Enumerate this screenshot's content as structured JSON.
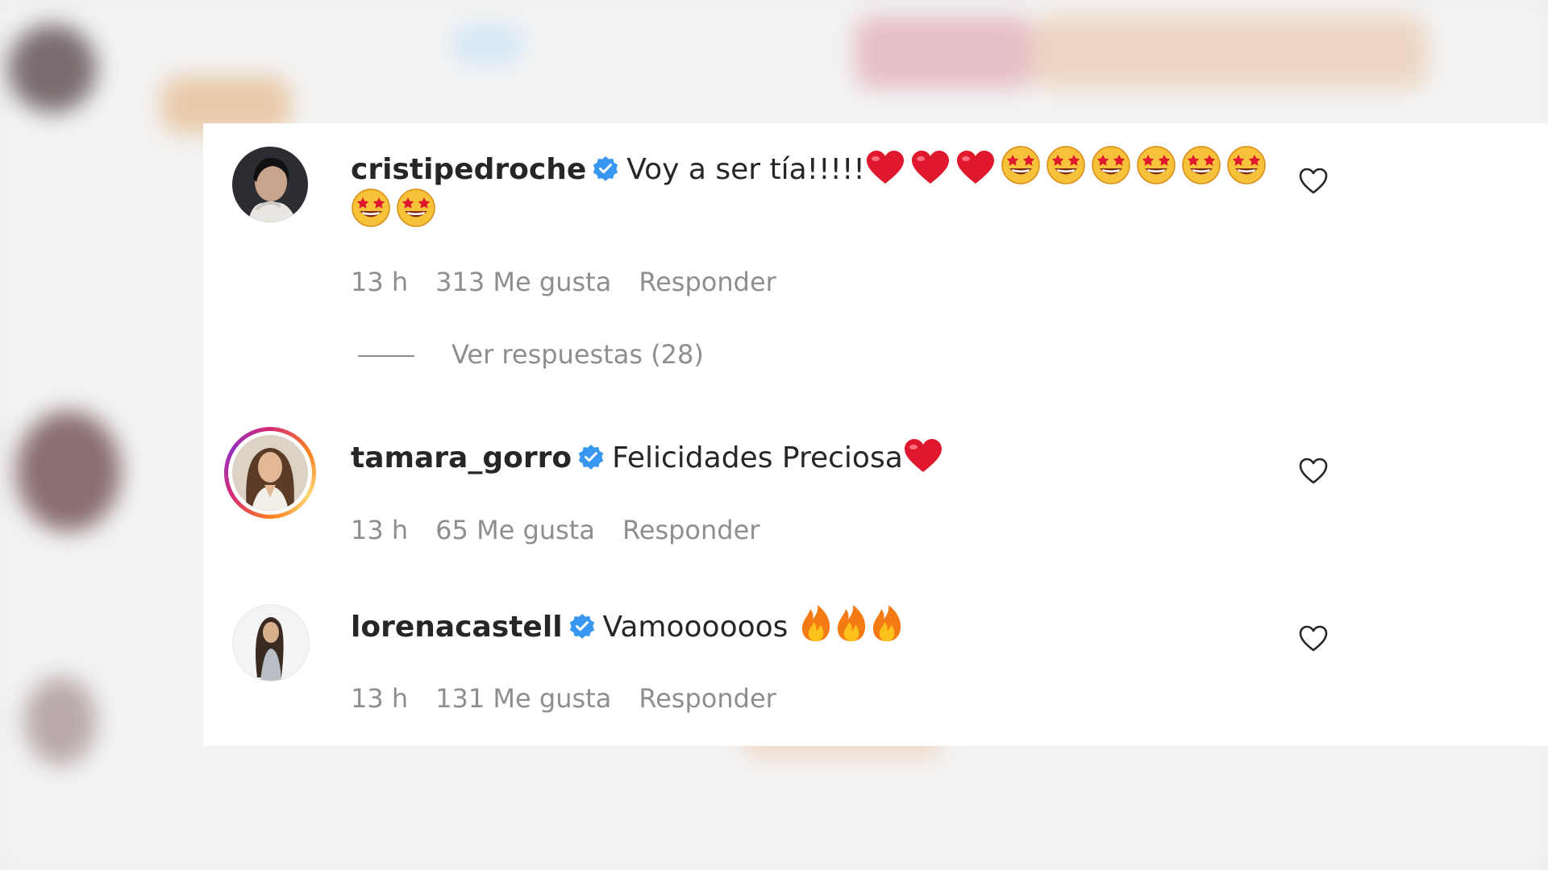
{
  "comments": [
    {
      "username": "cristipedroche",
      "verified": true,
      "text": "Voy a ser tía!!!!!",
      "emojis_line1": [
        "heart",
        "heart",
        "heart",
        "star-eyes",
        "star-eyes",
        "star-eyes",
        "star-eyes",
        "star-eyes",
        "star-eyes"
      ],
      "emojis_line2": [
        "star-eyes",
        "star-eyes"
      ],
      "time": "13 h",
      "likes": "313 Me gusta",
      "reply": "Responder"
    },
    {
      "username": "tamara_gorro",
      "verified": true,
      "text": "Felicidades Preciosa",
      "emojis_line1": [
        "heart"
      ],
      "time": "13 h",
      "likes": "65 Me gusta",
      "reply": "Responder"
    },
    {
      "username": "lorenacastell",
      "verified": true,
      "text": "Vamoooooos",
      "emojis_line1": [
        "fire",
        "fire",
        "fire"
      ],
      "time": "13 h",
      "likes": "131 Me gusta",
      "reply": "Responder"
    }
  ],
  "view_replies": "Ver respuestas (28)",
  "colors": {
    "verified": "#3897f0",
    "heart": "#e0182d",
    "meta": "#8e8e8e",
    "text": "#262626"
  }
}
